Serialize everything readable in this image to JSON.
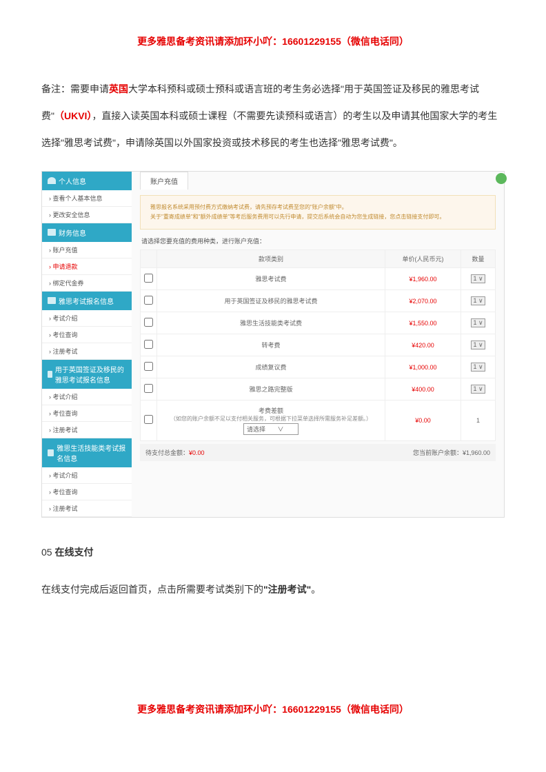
{
  "header_banner": "更多雅思备考资讯请添加环小吖：16601229155（微信电话同）",
  "note_prefix": "备注：需要申请",
  "note_red1": "英国",
  "note_mid1": "大学本科预科或硕士预科或语言班的考生务必选择\"用于英国签证及移民的雅思考试费\"",
  "note_red2": "（UKVI）",
  "note_mid2": "，直接入读英国本科或硕士课程（不需要先读预科或语言）的考生以及申请其他国家大学的考生选择\"雅思考试费\"，申请除英国以外国家投资或技术移民的考生也选择\"雅思考试费\"。",
  "sidebar": {
    "h1": "个人信息",
    "s1a": "› 查看个人基本信息",
    "s1b": "› 更改安全信息",
    "h2": "财务信息",
    "s2a": "› 账户充值",
    "s2b": "› 申请退款",
    "s2c": "› 绑定代金券",
    "h3": "雅思考试报名信息",
    "s3a": "› 考试介绍",
    "s3b": "› 考位查询",
    "s3c": "› 注册考试",
    "h4": "用于英国签证及移民的雅思考试报名信息",
    "s4a": "› 考试介绍",
    "s4b": "› 考位查询",
    "s4c": "› 注册考试",
    "h5": "雅思生活技能类考试报名信息",
    "s5a": "› 考试介绍",
    "s5b": "› 考位查询",
    "s5c": "› 注册考试"
  },
  "tab_label": "账户充值",
  "info_line1": "雅思报名系统采用预付费方式缴纳考试费，请先预存考试费至您的\"账户余额\"中。",
  "info_line2": "关于\"重寄成绩单\"和\"额外成绩单\"等考后服务费用可以先行申请，提交后系统会自动为您生成链接，您点击链接支付即可。",
  "prompt": "请选择您要充值的费用种类，进行账户充值：",
  "table": {
    "col_check": "",
    "col_type": "款项类别",
    "col_price": "单价(人民币元)",
    "col_qty": "数量",
    "rows": [
      {
        "name": "雅思考试费",
        "price": "¥1,960.00",
        "qty": "1 ∨"
      },
      {
        "name": "用于英国签证及移民的雅思考试费",
        "price": "¥2,070.00",
        "qty": "1 ∨"
      },
      {
        "name": "雅思生活技能类考试费",
        "price": "¥1,550.00",
        "qty": "1 ∨"
      },
      {
        "name": "转考费",
        "price": "¥420.00",
        "qty": "1 ∨"
      },
      {
        "name": "成绩复议费",
        "price": "¥1,000.00",
        "qty": "1 ∨"
      },
      {
        "name": "雅思之路完整版",
        "price": "¥400.00",
        "qty": "1 ∨"
      }
    ],
    "gap_name": "考费差额",
    "gap_desc": "（如您的账户余额不足以支付相关服务，可根据下拉菜单选择所需服务补足差额。）",
    "gap_select": "请选择",
    "gap_price": "¥0.00",
    "gap_qty": "1"
  },
  "totals_left_label": "待支付总金额：",
  "totals_left_value": "¥0.00",
  "totals_right_label": "您当前账户余额：",
  "totals_right_value": "¥1,960.00",
  "section_num": "05 ",
  "section_title": "在线支付",
  "body_text_pre": "在线支付完成后返回首页，点击所需要考试类别下的",
  "body_text_bold": "\"注册考试\"",
  "body_text_post": "。",
  "footer_banner": "更多雅思备考资讯请添加环小吖：16601229155（微信电话同）"
}
